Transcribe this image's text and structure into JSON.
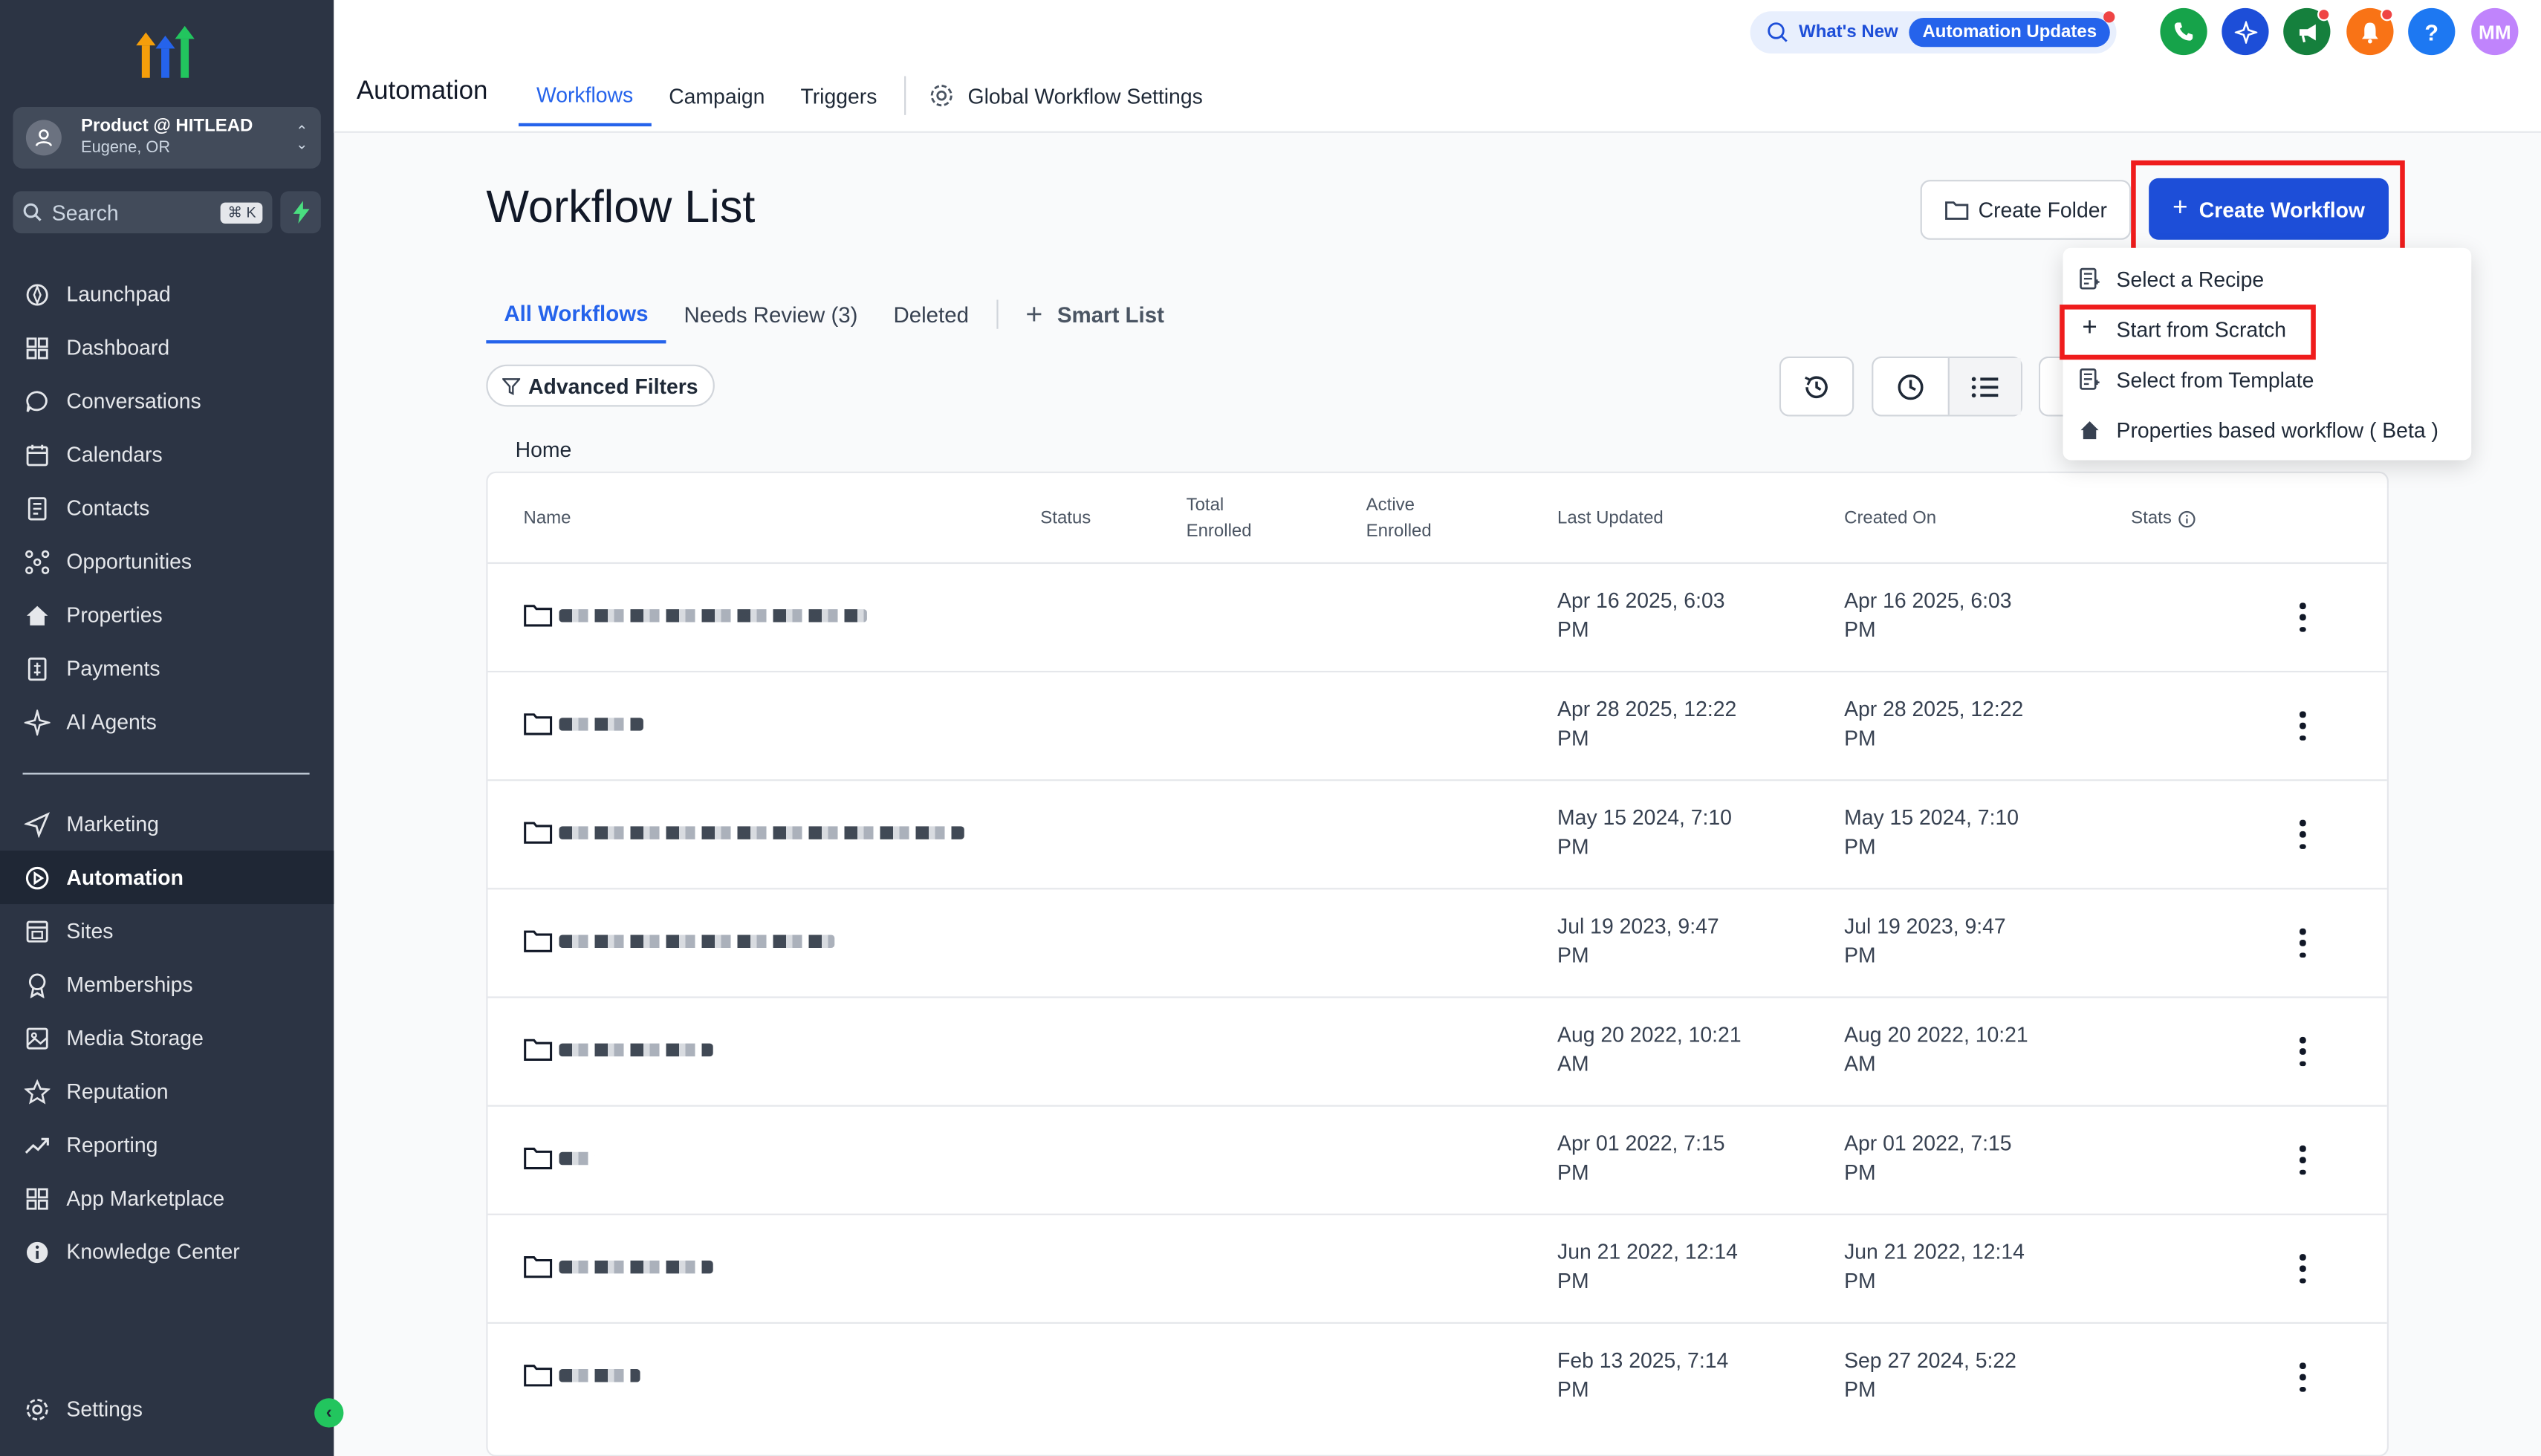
{
  "colors": {
    "sidebar_bg": "#2c3444",
    "primary": "#1d4ed8",
    "highlight": "#ef1c1c"
  },
  "location": {
    "name": "Product @ HITLEAD",
    "city": "Eugene, OR"
  },
  "search": {
    "label": "Search",
    "shortcut": "⌘ K"
  },
  "sidebar": {
    "items": [
      {
        "label": "Launchpad",
        "icon": "launchpad-icon"
      },
      {
        "label": "Dashboard",
        "icon": "dashboard-icon"
      },
      {
        "label": "Conversations",
        "icon": "chat-icon"
      },
      {
        "label": "Calendars",
        "icon": "calendar-icon"
      },
      {
        "label": "Contacts",
        "icon": "contacts-icon"
      },
      {
        "label": "Opportunities",
        "icon": "opportunities-icon"
      },
      {
        "label": "Properties",
        "icon": "home-icon"
      },
      {
        "label": "Payments",
        "icon": "payments-icon"
      },
      {
        "label": "AI Agents",
        "icon": "sparkle-icon"
      }
    ],
    "items2": [
      {
        "label": "Marketing",
        "icon": "send-icon"
      },
      {
        "label": "Automation",
        "icon": "automation-icon",
        "active": true
      },
      {
        "label": "Sites",
        "icon": "sites-icon"
      },
      {
        "label": "Memberships",
        "icon": "award-icon"
      },
      {
        "label": "Media Storage",
        "icon": "image-icon"
      },
      {
        "label": "Reputation",
        "icon": "star-icon"
      },
      {
        "label": "Reporting",
        "icon": "trend-icon"
      },
      {
        "label": "App Marketplace",
        "icon": "grid-icon"
      },
      {
        "label": "Knowledge Center",
        "icon": "info-icon"
      }
    ],
    "settings": "Settings"
  },
  "topbar": {
    "title": "Automation",
    "tabs": [
      "Workflows",
      "Campaign",
      "Triggers"
    ],
    "global_settings": "Global Workflow Settings",
    "whats_new": "What's New",
    "automation_updates": "Automation Updates",
    "help": "?",
    "avatar_initials": "MM"
  },
  "main": {
    "title": "Workflow List",
    "create_folder": "Create Folder",
    "create_workflow": "Create Workflow",
    "tabs": [
      "All Workflows",
      "Needs Review (3)",
      "Deleted"
    ],
    "smart_list": "Smart List",
    "advanced_filters": "Advanced Filters",
    "breadcrumb": "Home"
  },
  "dropdown": {
    "items": [
      "Select a Recipe",
      "Start from Scratch",
      "Select from Template",
      "Properties based workflow ( Beta )"
    ]
  },
  "table": {
    "headers": {
      "name": "Name",
      "status": "Status",
      "total_1": "Total",
      "total_2": "Enrolled",
      "active_1": "Active",
      "active_2": "Enrolled",
      "last_updated": "Last Updated",
      "created_on": "Created On",
      "stats": "Stats"
    },
    "rows": [
      {
        "updated_1": "Apr 16 2025, 6:03",
        "updated_2": "PM",
        "created_1": "Apr 16 2025, 6:03",
        "created_2": "PM"
      },
      {
        "updated_1": "Apr 28 2025, 12:22",
        "updated_2": "PM",
        "created_1": "Apr 28 2025, 12:22",
        "created_2": "PM"
      },
      {
        "updated_1": "May 15 2024, 7:10",
        "updated_2": "PM",
        "created_1": "May 15 2024, 7:10",
        "created_2": "PM"
      },
      {
        "updated_1": "Jul 19 2023, 9:47",
        "updated_2": "PM",
        "created_1": "Jul 19 2023, 9:47",
        "created_2": "PM"
      },
      {
        "updated_1": "Aug 20 2022, 10:21",
        "updated_2": "AM",
        "created_1": "Aug 20 2022, 10:21",
        "created_2": "AM"
      },
      {
        "updated_1": "Apr 01 2022, 7:15",
        "updated_2": "PM",
        "created_1": "Apr 01 2022, 7:15",
        "created_2": "PM"
      },
      {
        "updated_1": "Jun 21 2022, 12:14",
        "updated_2": "PM",
        "created_1": "Jun 21 2022, 12:14",
        "created_2": "PM"
      },
      {
        "updated_1": "Feb 13 2025, 7:14",
        "updated_2": "PM",
        "created_1": "Sep 27 2024, 5:22",
        "created_2": "PM"
      }
    ]
  }
}
